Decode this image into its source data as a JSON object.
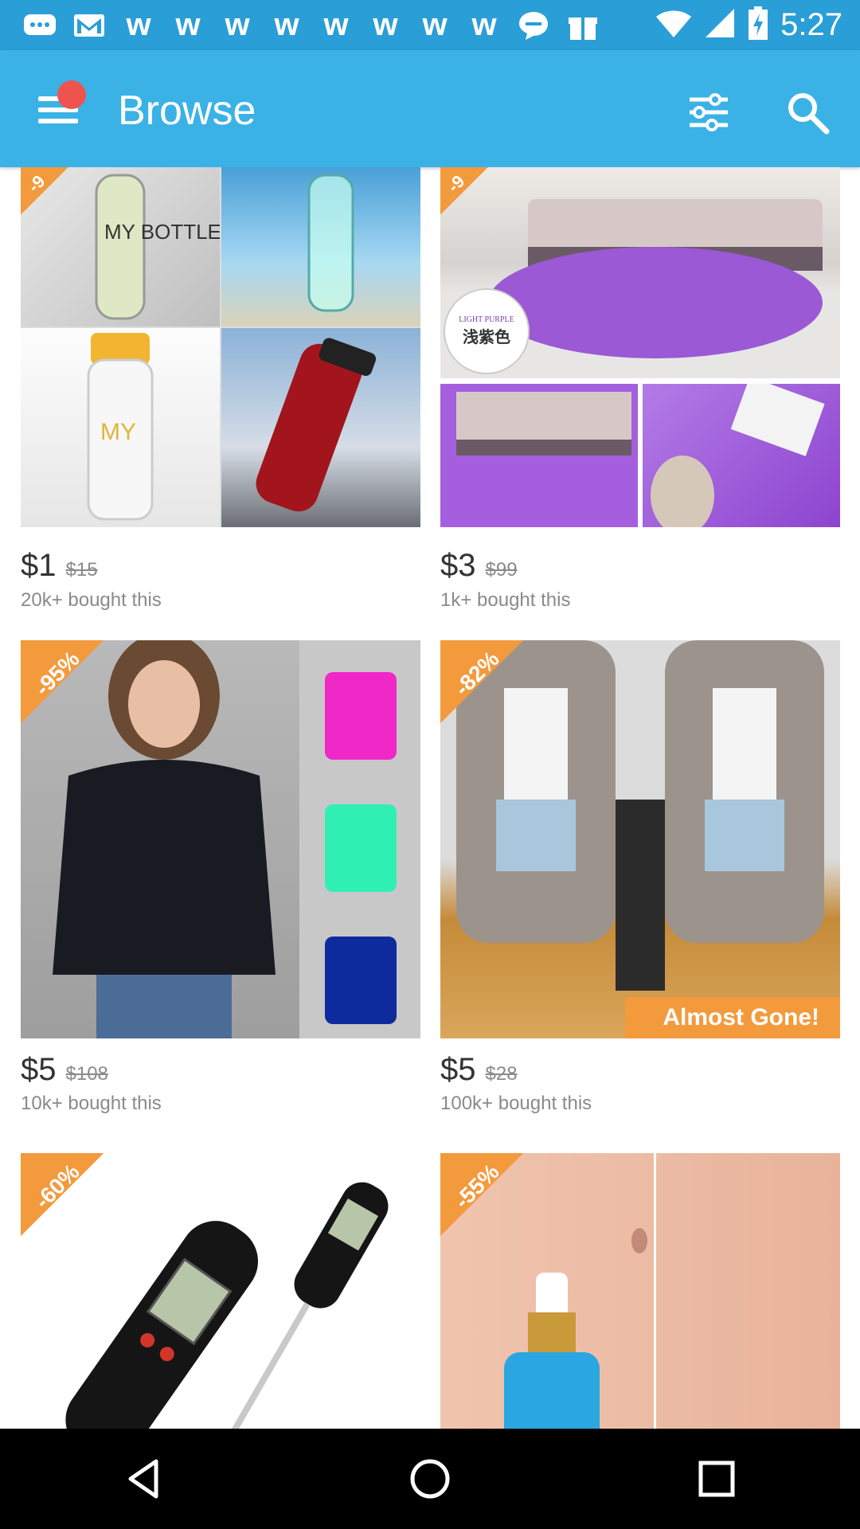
{
  "status_bar": {
    "time": "5:27",
    "icons": [
      "chat-icon",
      "gmail-icon",
      "wish-icon",
      "wish-icon",
      "wish-icon",
      "wish-icon",
      "wish-icon",
      "wish-icon",
      "wish-icon",
      "wish-icon",
      "messenger-icon",
      "gift-icon",
      "wifi-icon",
      "signal-icon",
      "battery-icon"
    ]
  },
  "app_bar": {
    "title": "Browse",
    "accent": "#3bb2e6",
    "notification_dot_color": "#ef5350"
  },
  "products": [
    {
      "discount": "-9",
      "price": "$1",
      "old_price": "$15",
      "bought": "20k+ bought this",
      "image": "water-bottles",
      "sub_labels": [
        "MY BOTTLE"
      ]
    },
    {
      "discount": "-9",
      "price": "$3",
      "old_price": "$99",
      "bought": "1k+ bought this",
      "image": "purple-rug",
      "sub_labels": [
        "LIGHT PURPLE",
        "浅紫色"
      ]
    },
    {
      "discount": "-95%",
      "price": "$5",
      "old_price": "$108",
      "bought": "10k+ bought this",
      "image": "off-shoulder-tops"
    },
    {
      "discount": "-82%",
      "price": "$5",
      "old_price": "$28",
      "bought": "100k+ bought this",
      "image": "knit-cardigan",
      "tag": "Almost Gone!"
    },
    {
      "discount": "-60%",
      "image": "food-thermometer"
    },
    {
      "discount": "-55%",
      "image": "serum-bottle"
    }
  ],
  "nav": {
    "back": "back-icon",
    "home": "home-icon",
    "recents": "recents-icon"
  }
}
